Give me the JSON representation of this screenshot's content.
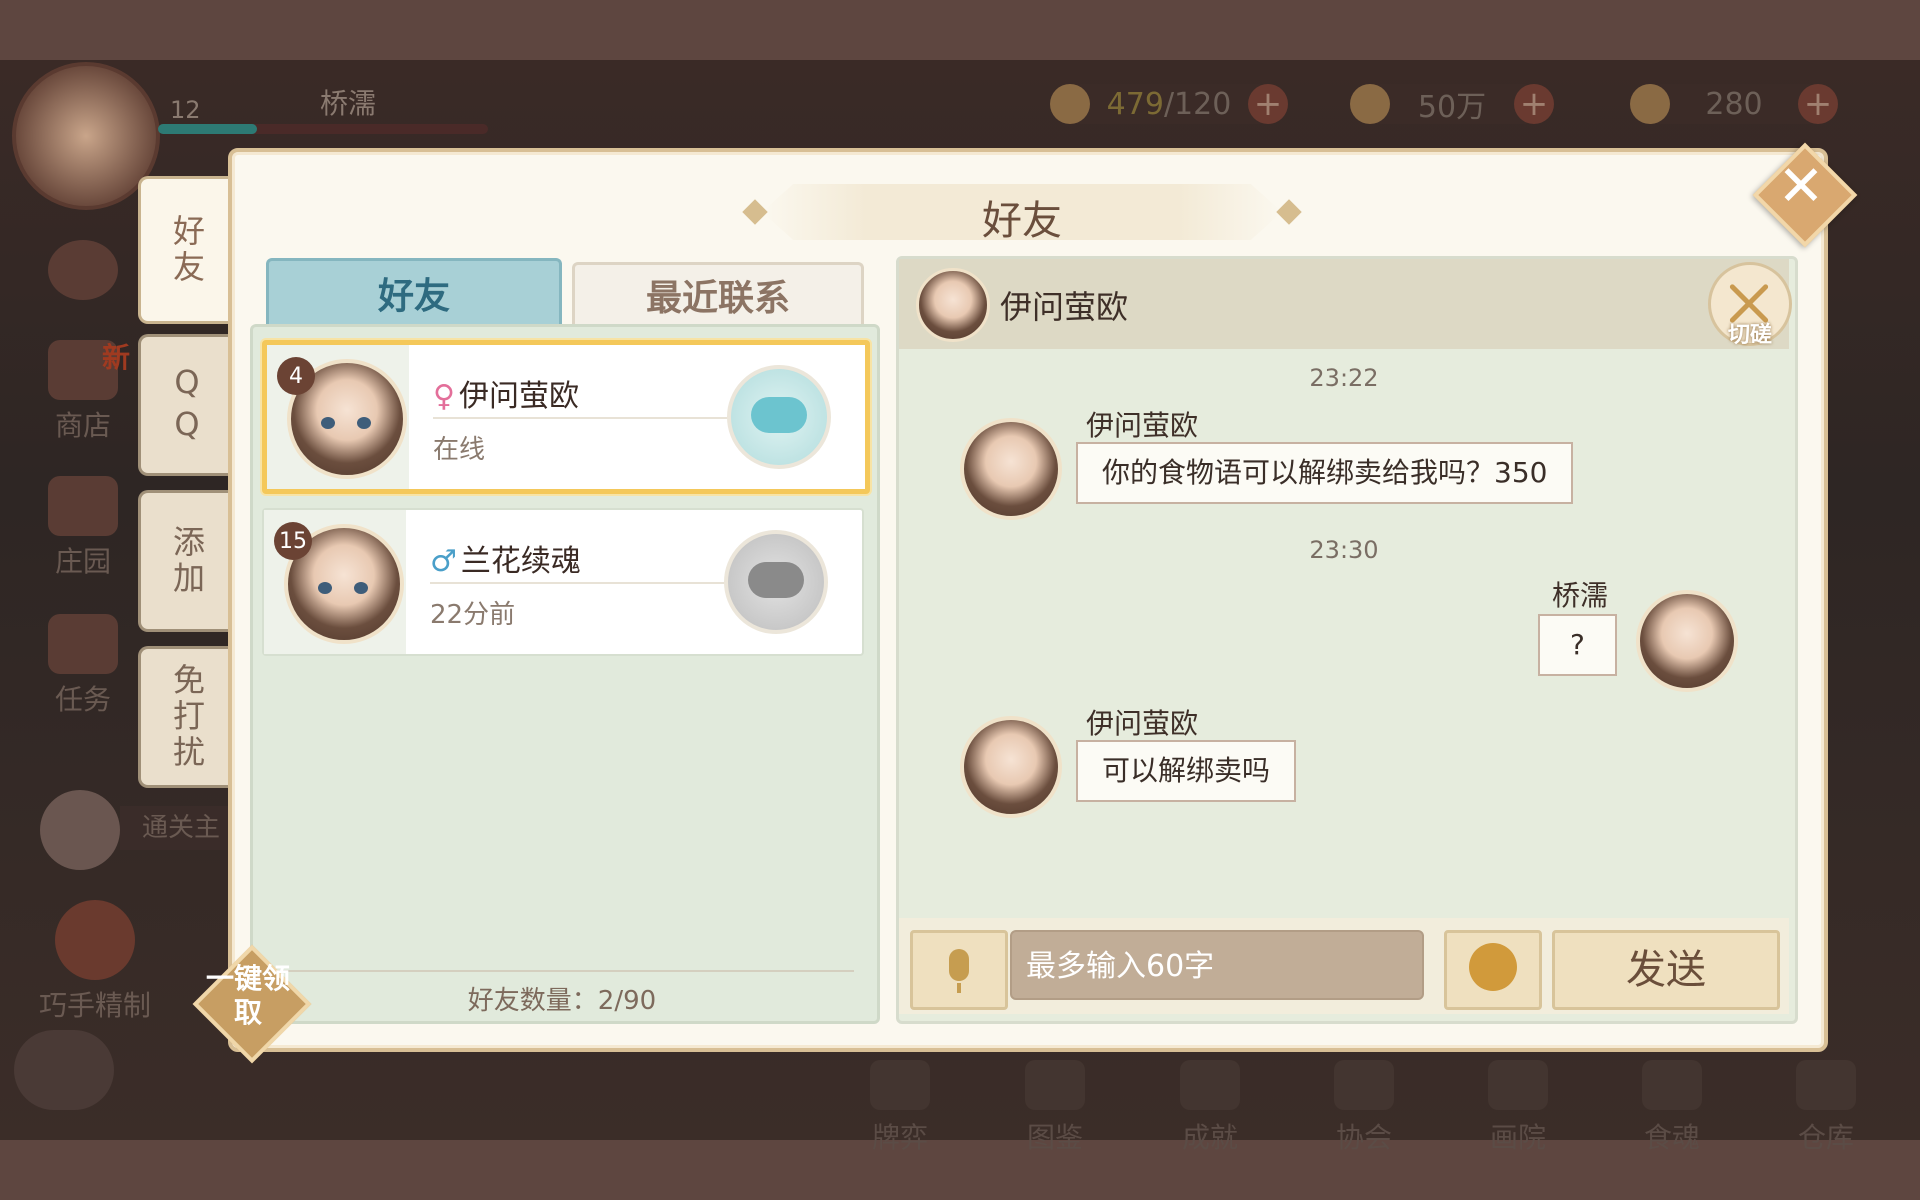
{
  "hud": {
    "player_level": "12",
    "player_name": "桥濡",
    "exp_progress": 0.3,
    "resources": [
      {
        "icon": "bowl-icon",
        "value_current": "479",
        "value_max": "/120"
      },
      {
        "icon": "coin-icon",
        "value": "50万"
      },
      {
        "icon": "jade-icon",
        "value": "280"
      }
    ]
  },
  "background_menu": [
    {
      "label": "商店",
      "badge": "新"
    },
    {
      "label": "庄园"
    },
    {
      "label": "任务"
    },
    {
      "label": "通关主"
    },
    {
      "label": "巧手精制"
    }
  ],
  "bottom_bar": [
    "牌弈",
    "图鉴",
    "成就",
    "协会",
    "画院",
    "食魂",
    "仓库"
  ],
  "side_tabs": [
    "好友",
    "QQ",
    "添加",
    "免打扰"
  ],
  "panel": {
    "title": "好友",
    "tabs": [
      {
        "label": "好友",
        "active": true
      },
      {
        "label": "最近联系",
        "active": false
      }
    ],
    "friends": [
      {
        "level": "4",
        "gender": "♀",
        "gender_color": "#e36f9a",
        "name": "伊问萤欧",
        "status": "在线",
        "selected": true
      },
      {
        "level": "15",
        "gender": "♂",
        "gender_color": "#4a9fc9",
        "name": "兰花续魂",
        "status": "22分前",
        "selected": false
      }
    ],
    "friend_count": "好友数量：2/90",
    "claim_button": "一键领取"
  },
  "chat": {
    "contact_name": "伊问萤欧",
    "duel_label": "切磋",
    "messages": [
      {
        "timestamp": "23:22"
      },
      {
        "sender": "伊问萤欧",
        "text": "你的食物语可以解绑卖给我吗？350",
        "side": "left"
      },
      {
        "timestamp": "23:30"
      },
      {
        "sender": "桥濡",
        "text": "?",
        "side": "right"
      },
      {
        "sender": "伊问萤欧",
        "text": "可以解绑卖吗",
        "side": "left"
      }
    ],
    "input_placeholder": "最多输入60字",
    "send_label": "发送"
  }
}
